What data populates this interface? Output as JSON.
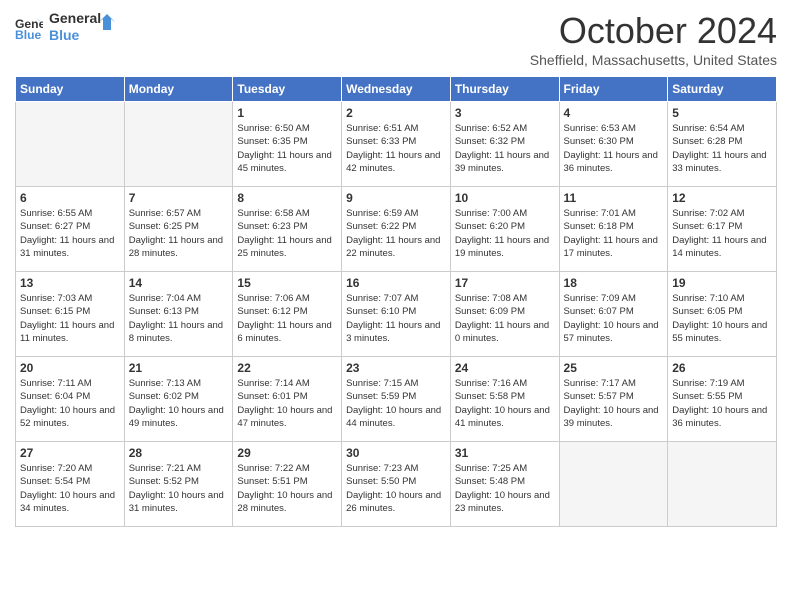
{
  "logo": {
    "line1": "General",
    "line2": "Blue"
  },
  "title": "October 2024",
  "subtitle": "Sheffield, Massachusetts, United States",
  "days_of_week": [
    "Sunday",
    "Monday",
    "Tuesday",
    "Wednesday",
    "Thursday",
    "Friday",
    "Saturday"
  ],
  "weeks": [
    [
      {
        "num": "",
        "sunrise": "",
        "sunset": "",
        "daylight": ""
      },
      {
        "num": "",
        "sunrise": "",
        "sunset": "",
        "daylight": ""
      },
      {
        "num": "1",
        "sunrise": "Sunrise: 6:50 AM",
        "sunset": "Sunset: 6:35 PM",
        "daylight": "Daylight: 11 hours and 45 minutes."
      },
      {
        "num": "2",
        "sunrise": "Sunrise: 6:51 AM",
        "sunset": "Sunset: 6:33 PM",
        "daylight": "Daylight: 11 hours and 42 minutes."
      },
      {
        "num": "3",
        "sunrise": "Sunrise: 6:52 AM",
        "sunset": "Sunset: 6:32 PM",
        "daylight": "Daylight: 11 hours and 39 minutes."
      },
      {
        "num": "4",
        "sunrise": "Sunrise: 6:53 AM",
        "sunset": "Sunset: 6:30 PM",
        "daylight": "Daylight: 11 hours and 36 minutes."
      },
      {
        "num": "5",
        "sunrise": "Sunrise: 6:54 AM",
        "sunset": "Sunset: 6:28 PM",
        "daylight": "Daylight: 11 hours and 33 minutes."
      }
    ],
    [
      {
        "num": "6",
        "sunrise": "Sunrise: 6:55 AM",
        "sunset": "Sunset: 6:27 PM",
        "daylight": "Daylight: 11 hours and 31 minutes."
      },
      {
        "num": "7",
        "sunrise": "Sunrise: 6:57 AM",
        "sunset": "Sunset: 6:25 PM",
        "daylight": "Daylight: 11 hours and 28 minutes."
      },
      {
        "num": "8",
        "sunrise": "Sunrise: 6:58 AM",
        "sunset": "Sunset: 6:23 PM",
        "daylight": "Daylight: 11 hours and 25 minutes."
      },
      {
        "num": "9",
        "sunrise": "Sunrise: 6:59 AM",
        "sunset": "Sunset: 6:22 PM",
        "daylight": "Daylight: 11 hours and 22 minutes."
      },
      {
        "num": "10",
        "sunrise": "Sunrise: 7:00 AM",
        "sunset": "Sunset: 6:20 PM",
        "daylight": "Daylight: 11 hours and 19 minutes."
      },
      {
        "num": "11",
        "sunrise": "Sunrise: 7:01 AM",
        "sunset": "Sunset: 6:18 PM",
        "daylight": "Daylight: 11 hours and 17 minutes."
      },
      {
        "num": "12",
        "sunrise": "Sunrise: 7:02 AM",
        "sunset": "Sunset: 6:17 PM",
        "daylight": "Daylight: 11 hours and 14 minutes."
      }
    ],
    [
      {
        "num": "13",
        "sunrise": "Sunrise: 7:03 AM",
        "sunset": "Sunset: 6:15 PM",
        "daylight": "Daylight: 11 hours and 11 minutes."
      },
      {
        "num": "14",
        "sunrise": "Sunrise: 7:04 AM",
        "sunset": "Sunset: 6:13 PM",
        "daylight": "Daylight: 11 hours and 8 minutes."
      },
      {
        "num": "15",
        "sunrise": "Sunrise: 7:06 AM",
        "sunset": "Sunset: 6:12 PM",
        "daylight": "Daylight: 11 hours and 6 minutes."
      },
      {
        "num": "16",
        "sunrise": "Sunrise: 7:07 AM",
        "sunset": "Sunset: 6:10 PM",
        "daylight": "Daylight: 11 hours and 3 minutes."
      },
      {
        "num": "17",
        "sunrise": "Sunrise: 7:08 AM",
        "sunset": "Sunset: 6:09 PM",
        "daylight": "Daylight: 11 hours and 0 minutes."
      },
      {
        "num": "18",
        "sunrise": "Sunrise: 7:09 AM",
        "sunset": "Sunset: 6:07 PM",
        "daylight": "Daylight: 10 hours and 57 minutes."
      },
      {
        "num": "19",
        "sunrise": "Sunrise: 7:10 AM",
        "sunset": "Sunset: 6:05 PM",
        "daylight": "Daylight: 10 hours and 55 minutes."
      }
    ],
    [
      {
        "num": "20",
        "sunrise": "Sunrise: 7:11 AM",
        "sunset": "Sunset: 6:04 PM",
        "daylight": "Daylight: 10 hours and 52 minutes."
      },
      {
        "num": "21",
        "sunrise": "Sunrise: 7:13 AM",
        "sunset": "Sunset: 6:02 PM",
        "daylight": "Daylight: 10 hours and 49 minutes."
      },
      {
        "num": "22",
        "sunrise": "Sunrise: 7:14 AM",
        "sunset": "Sunset: 6:01 PM",
        "daylight": "Daylight: 10 hours and 47 minutes."
      },
      {
        "num": "23",
        "sunrise": "Sunrise: 7:15 AM",
        "sunset": "Sunset: 5:59 PM",
        "daylight": "Daylight: 10 hours and 44 minutes."
      },
      {
        "num": "24",
        "sunrise": "Sunrise: 7:16 AM",
        "sunset": "Sunset: 5:58 PM",
        "daylight": "Daylight: 10 hours and 41 minutes."
      },
      {
        "num": "25",
        "sunrise": "Sunrise: 7:17 AM",
        "sunset": "Sunset: 5:57 PM",
        "daylight": "Daylight: 10 hours and 39 minutes."
      },
      {
        "num": "26",
        "sunrise": "Sunrise: 7:19 AM",
        "sunset": "Sunset: 5:55 PM",
        "daylight": "Daylight: 10 hours and 36 minutes."
      }
    ],
    [
      {
        "num": "27",
        "sunrise": "Sunrise: 7:20 AM",
        "sunset": "Sunset: 5:54 PM",
        "daylight": "Daylight: 10 hours and 34 minutes."
      },
      {
        "num": "28",
        "sunrise": "Sunrise: 7:21 AM",
        "sunset": "Sunset: 5:52 PM",
        "daylight": "Daylight: 10 hours and 31 minutes."
      },
      {
        "num": "29",
        "sunrise": "Sunrise: 7:22 AM",
        "sunset": "Sunset: 5:51 PM",
        "daylight": "Daylight: 10 hours and 28 minutes."
      },
      {
        "num": "30",
        "sunrise": "Sunrise: 7:23 AM",
        "sunset": "Sunset: 5:50 PM",
        "daylight": "Daylight: 10 hours and 26 minutes."
      },
      {
        "num": "31",
        "sunrise": "Sunrise: 7:25 AM",
        "sunset": "Sunset: 5:48 PM",
        "daylight": "Daylight: 10 hours and 23 minutes."
      },
      {
        "num": "",
        "sunrise": "",
        "sunset": "",
        "daylight": ""
      },
      {
        "num": "",
        "sunrise": "",
        "sunset": "",
        "daylight": ""
      }
    ]
  ]
}
